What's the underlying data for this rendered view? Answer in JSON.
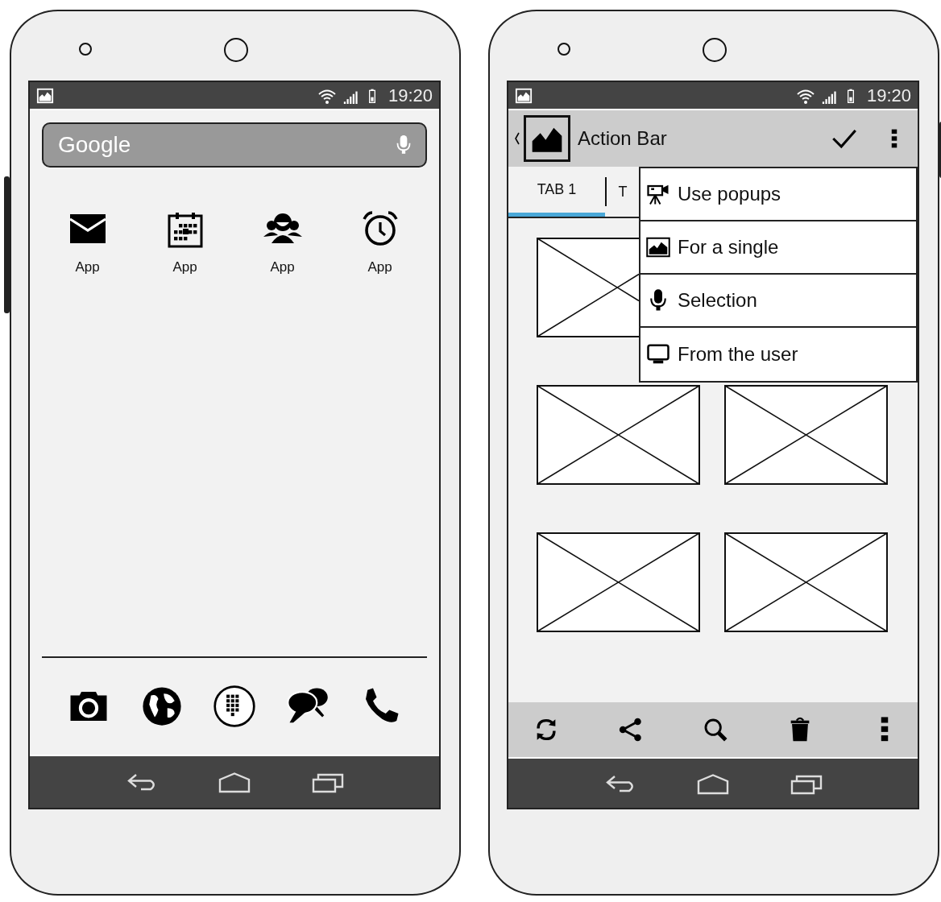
{
  "home_screen": {
    "status_bar": {
      "time": "19:20"
    },
    "search": {
      "placeholder": "Google"
    },
    "apps": [
      {
        "label": "App"
      },
      {
        "label": "App"
      },
      {
        "label": "App"
      },
      {
        "label": "App"
      }
    ]
  },
  "action_screen": {
    "status_bar": {
      "time": "19:20"
    },
    "action_bar": {
      "title": "Action Bar"
    },
    "tabs": [
      {
        "label": "TAB 1",
        "selected": true
      },
      {
        "label": "T",
        "selected": false
      }
    ],
    "menu": {
      "items": [
        {
          "label": "Use popups"
        },
        {
          "label": "For a single"
        },
        {
          "label": "Selection"
        },
        {
          "label": "From the user"
        }
      ]
    }
  }
}
